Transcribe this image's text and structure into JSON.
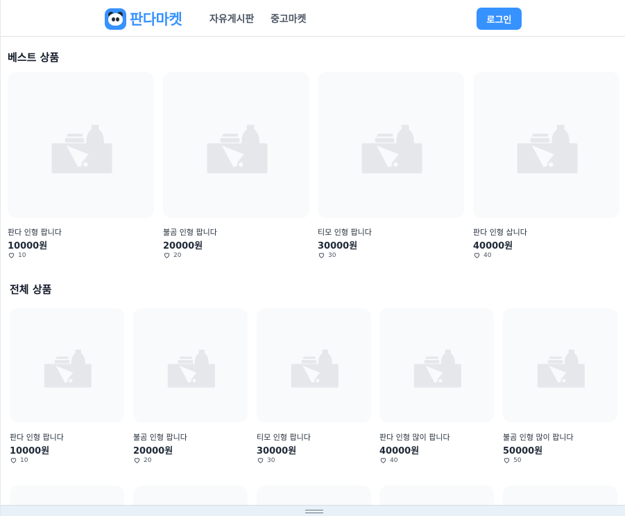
{
  "header": {
    "logo_text": "판다마켓",
    "nav": [
      "자유게시판",
      "중고마켓"
    ],
    "login_label": "로그인"
  },
  "best": {
    "title": "베스트 상품",
    "items": [
      {
        "name": "판다 인형 팝니다",
        "price": "10000원",
        "likes": "10"
      },
      {
        "name": "불곰 인형 팝니다",
        "price": "20000원",
        "likes": "20"
      },
      {
        "name": "티모 인형 팝니다",
        "price": "30000원",
        "likes": "30"
      },
      {
        "name": "판다 인형 삽니다",
        "price": "40000원",
        "likes": "40"
      }
    ]
  },
  "all": {
    "title": "전체 상품",
    "items": [
      {
        "name": "판다 인형 팝니다",
        "price": "10000원",
        "likes": "10"
      },
      {
        "name": "불곰 인형 팝니다",
        "price": "20000원",
        "likes": "20"
      },
      {
        "name": "티모 인형 팝니다",
        "price": "30000원",
        "likes": "30"
      },
      {
        "name": "판다 인형 많이 팝니다",
        "price": "40000원",
        "likes": "40"
      },
      {
        "name": "불곰 인형 많이 팝니다",
        "price": "50000원",
        "likes": "50"
      }
    ]
  },
  "colors": {
    "accent": "#3692ff",
    "placeholder_bg": "#f9fafb",
    "placeholder_icon": "#e5e7eb"
  },
  "icons": {
    "placeholder": "image-placeholder-icon",
    "like": "heart-icon"
  }
}
